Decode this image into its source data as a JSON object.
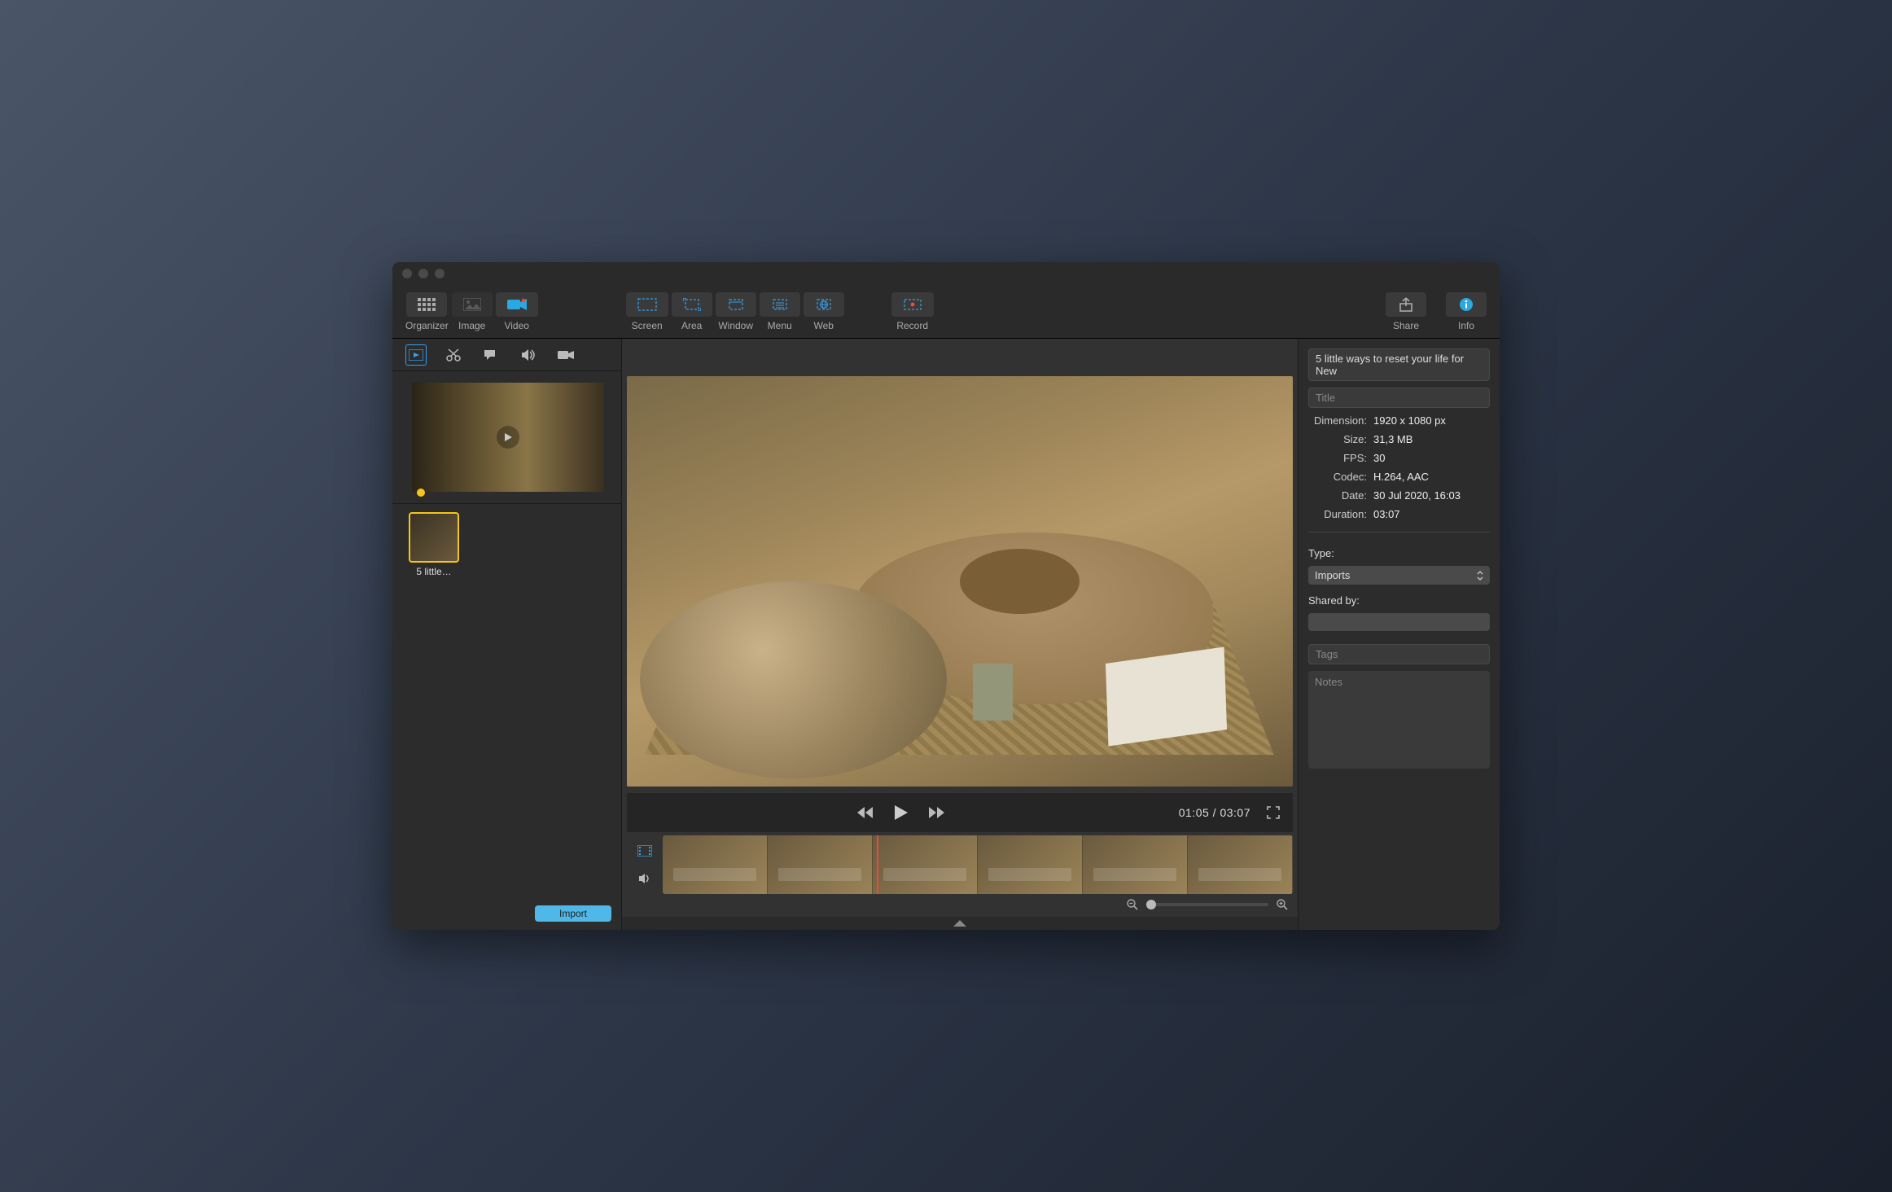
{
  "toolbar": {
    "organizer": "Organizer",
    "image": "Image",
    "video": "Video",
    "screen": "Screen",
    "area": "Area",
    "window": "Window",
    "menu": "Menu",
    "web": "Web",
    "record": "Record",
    "share": "Share",
    "info": "Info"
  },
  "left": {
    "clip_label": "5 little…",
    "import": "Import"
  },
  "player": {
    "time": "01:05 / 03:07"
  },
  "info": {
    "filename": "5 little ways to reset your life for New",
    "title_placeholder": "Title",
    "rows": {
      "dimension_label": "Dimension:",
      "dimension": "1920 x 1080 px",
      "size_label": "Size:",
      "size": "31,3 MB",
      "fps_label": "FPS:",
      "fps": "30",
      "codec_label": "Codec:",
      "codec": "H.264, AAC",
      "date_label": "Date:",
      "date": "30 Jul 2020, 16:03",
      "duration_label": "Duration:",
      "duration": "03:07"
    },
    "type_label": "Type:",
    "type_value": "Imports",
    "shared_by_label": "Shared by:",
    "tags_placeholder": "Tags",
    "notes_placeholder": "Notes"
  }
}
